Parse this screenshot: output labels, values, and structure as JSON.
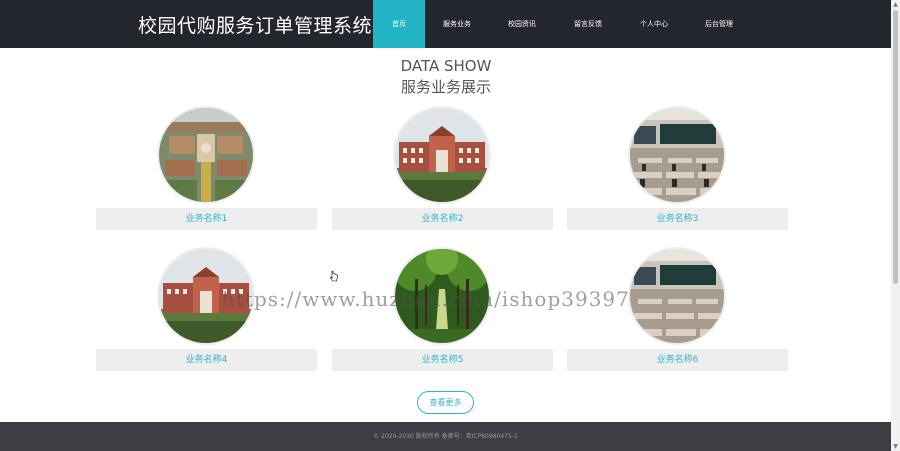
{
  "header": {
    "site_title": "校园代购服务订单管理系统",
    "nav": [
      {
        "label": "首页",
        "active": true
      },
      {
        "label": "服务业务",
        "active": false
      },
      {
        "label": "校园资讯",
        "active": false
      },
      {
        "label": "留言反馈",
        "active": false
      },
      {
        "label": "个人中心",
        "active": false
      },
      {
        "label": "后台管理",
        "active": false
      }
    ]
  },
  "section": {
    "title_en": "DATA SHOW",
    "title_cn": "服务业务展示"
  },
  "services": [
    {
      "name": "业务名称1",
      "image": "campus-aerial-photo"
    },
    {
      "name": "业务名称2",
      "image": "school-building-photo"
    },
    {
      "name": "业务名称3",
      "image": "classroom-photo"
    },
    {
      "name": "业务名称4",
      "image": "school-building-photo"
    },
    {
      "name": "业务名称5",
      "image": "tree-lined-path-photo"
    },
    {
      "name": "业务名称6",
      "image": "classroom-photo"
    }
  ],
  "more_button": "查看更多",
  "watermark": "https://www.huzhan.com/ishop39397",
  "footer": {
    "copyright": "© 2020-2030 版权所有 备案号：粤ICP60980475-1"
  },
  "colors": {
    "header_bg": "#23262d",
    "accent": "#22b3c5",
    "footer_bg": "#3c3e42"
  }
}
